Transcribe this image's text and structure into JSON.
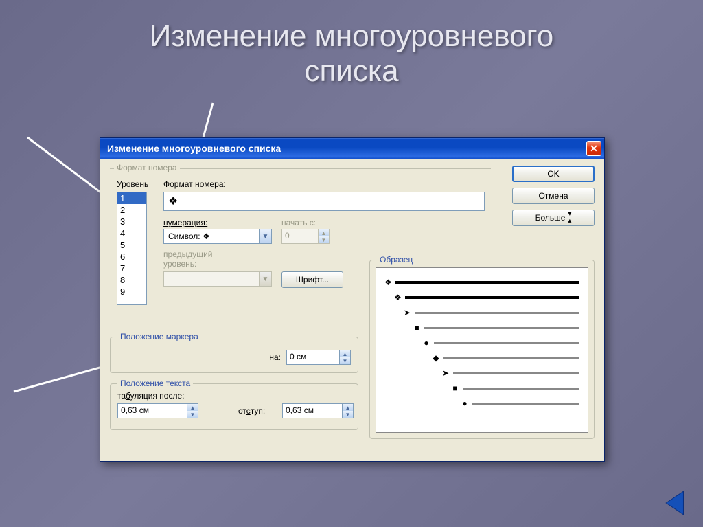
{
  "slide": {
    "title_line1": "Изменение многоуровневого",
    "title_line2": "списка"
  },
  "dialog": {
    "title": "Изменение многоуровневого списка",
    "buttons": {
      "ok": "OK",
      "cancel": "Отмена",
      "more": "Больше"
    },
    "number_format": {
      "group_label": "Формат номера",
      "level_label": "Уровень",
      "format_label": "Формат номера:",
      "levels": [
        "1",
        "2",
        "3",
        "4",
        "5",
        "6",
        "7",
        "8",
        "9"
      ],
      "selected_level": "1",
      "format_value": "❖",
      "numbering_label": "нумерация:",
      "numbering_value": "Символ: ❖",
      "start_label": "начать с:",
      "start_value": "0",
      "prev_level_label": "предыдущий\nуровень:",
      "font_button": "Шрифт..."
    },
    "marker_position": {
      "group_label": "Положение маркера",
      "at_label": "на:",
      "at_value": "0 см"
    },
    "text_position": {
      "group_label": "Положение текста",
      "tab_after_label": "табуляция после:",
      "tab_after_value": "0,63 см",
      "indent_label": "отступ:",
      "indent_value": "0,63 см"
    },
    "sample": {
      "group_label": "Образец",
      "bullets": [
        "❖",
        "❖",
        "➤",
        "■",
        "●",
        "◆",
        "➤",
        "■",
        "●"
      ]
    }
  }
}
